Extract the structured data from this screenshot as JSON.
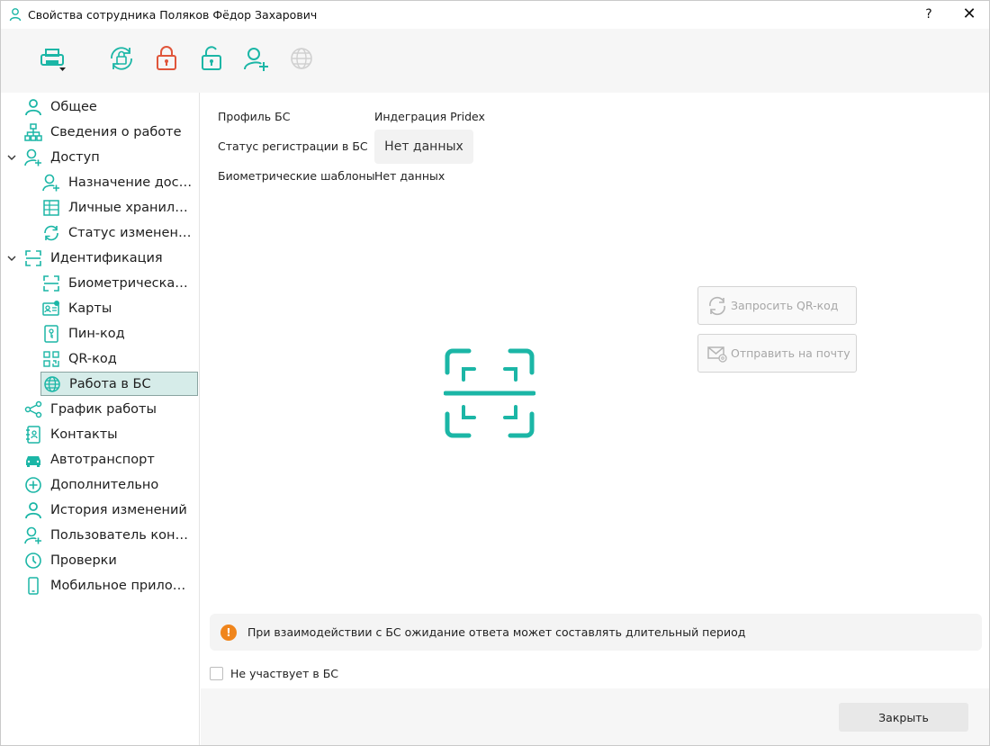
{
  "window": {
    "title": "Свойства сотрудника Поляков Фёдор Захарович",
    "help_label": "?",
    "close_label": "✕"
  },
  "toolbar": {
    "buttons": [
      "printer-dropdown-icon",
      "sync-lock-icon",
      "lock-closed-icon",
      "lock-open-icon",
      "user-add-icon",
      "globe-icon"
    ]
  },
  "sidebar": {
    "items": [
      {
        "label": "Общее",
        "icon": "person-icon"
      },
      {
        "label": "Сведения о работе",
        "icon": "org-chart-icon"
      },
      {
        "label": "Доступ",
        "icon": "person-key-icon",
        "expanded": true
      },
      {
        "label": "Назначение доступа",
        "icon": "person-add-icon"
      },
      {
        "label": "Личные хранилища",
        "icon": "grid-icon"
      },
      {
        "label": "Статус изменений",
        "icon": "refresh-icon"
      },
      {
        "label": "Идентификация",
        "icon": "scan-frame-icon",
        "expanded": true
      },
      {
        "label": "Биометрическая идентификация",
        "icon": "scan-frame-icon"
      },
      {
        "label": "Карты",
        "icon": "card-icon"
      },
      {
        "label": "Пин-код",
        "icon": "pin-icon"
      },
      {
        "label": "QR-код",
        "icon": "qr-icon"
      },
      {
        "label": "Работа в БС",
        "icon": "globe-icon",
        "selected": true
      },
      {
        "label": "График работы",
        "icon": "share-icon"
      },
      {
        "label": "Контакты",
        "icon": "contacts-icon"
      },
      {
        "label": "Автотранспорт",
        "icon": "car-icon"
      },
      {
        "label": "Дополнительно",
        "icon": "plus-circle-icon"
      },
      {
        "label": "История изменений",
        "icon": "person-icon"
      },
      {
        "label": "Пользователь контроллера",
        "icon": "person-add-icon"
      },
      {
        "label": "Проверки",
        "icon": "clock-icon"
      },
      {
        "label": "Мобильное приложение",
        "icon": "phone-icon"
      }
    ]
  },
  "main": {
    "profile_label": "Профиль БС",
    "profile_value": "Индеграция Pridex",
    "status_label": "Статус регистрации в БС",
    "status_value": "Нет данных",
    "templates_label": "Биометрические шаблоны",
    "templates_value": "Нет данных",
    "request_qr_label": "Запросить QR-код",
    "send_email_label": "Отправить на почту",
    "notice_text": "При взаимодействии с БС ожидание ответа может составлять длительный период",
    "notice_icon": "!",
    "not_participating_label": "Не участвует в БС",
    "not_participating_checked": false
  },
  "footer": {
    "close_label": "Закрыть"
  },
  "colors": {
    "accent_teal": "#1bb6a6",
    "lock_red": "#e0553a",
    "warning_orange": "#f0851c",
    "selected_bg": "#d6ece9",
    "disabled_text": "#a7a7a7"
  }
}
